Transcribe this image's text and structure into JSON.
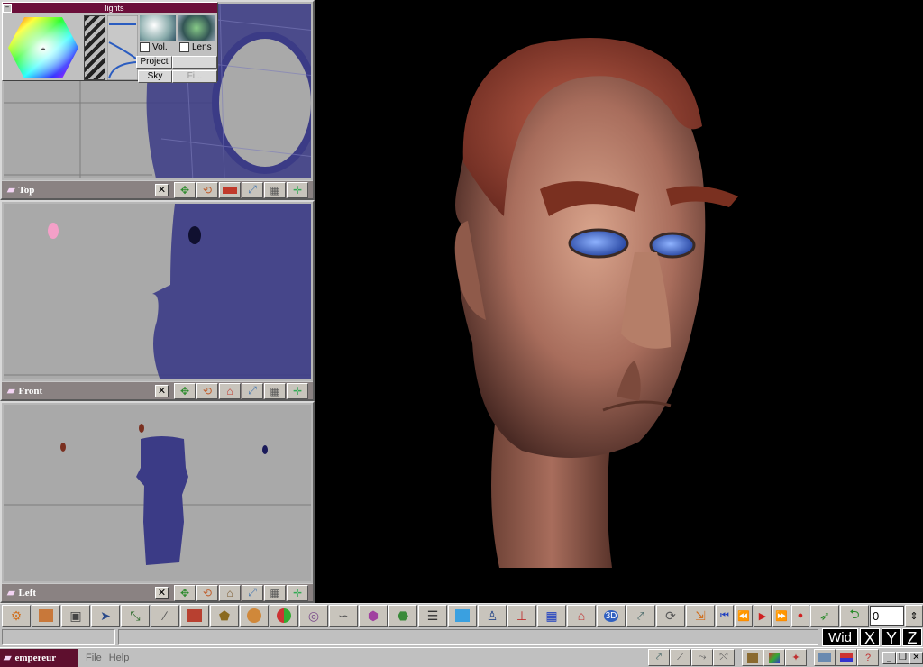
{
  "lights_panel": {
    "title": "lights",
    "collapse_glyph": "–",
    "vol_label": "Vol.",
    "lens_label": "Lens",
    "project_label": "Project",
    "sky_label": "Sky",
    "extra_label": "Fi..."
  },
  "viewports": [
    {
      "name": "Top",
      "close_glyph": "✕"
    },
    {
      "name": "Front",
      "close_glyph": "✕"
    },
    {
      "name": "Left",
      "close_glyph": "✕"
    }
  ],
  "toolbar": {
    "frame_value": "0",
    "icons": [
      "plugin-icon",
      "cube-icon",
      "camera-icon",
      "pointer-icon",
      "move-icon",
      "spline-icon",
      "box-icon",
      "extrude-icon",
      "sphere-icon",
      "color-sphere-icon",
      "torus-icon",
      "bezier-icon",
      "cylinder-icon",
      "lathe-icon",
      "grid-list-icon",
      "cube-blue-icon",
      "figure-icon",
      "axis-icon",
      "grid-icon",
      "house-icon",
      "view3d-icon",
      "skeleton-icon",
      "rotate-icon",
      "scale-icon"
    ],
    "transport": [
      "first-frame-icon",
      "rewind-icon",
      "play-icon",
      "fast-forward-icon",
      "record-icon"
    ]
  },
  "status": {
    "axis_wid": "Wid",
    "axis_x": "X",
    "axis_y": "Y",
    "axis_z": "Z"
  },
  "taskbar": {
    "app_name": "empereur",
    "file_menu": "File",
    "help_menu": "Help"
  },
  "colors": {
    "mesh": "#3b3b86",
    "viewport_bg": "#a9a9a9",
    "title_bar": "#8a8282",
    "brand": "#5e0f2e"
  }
}
